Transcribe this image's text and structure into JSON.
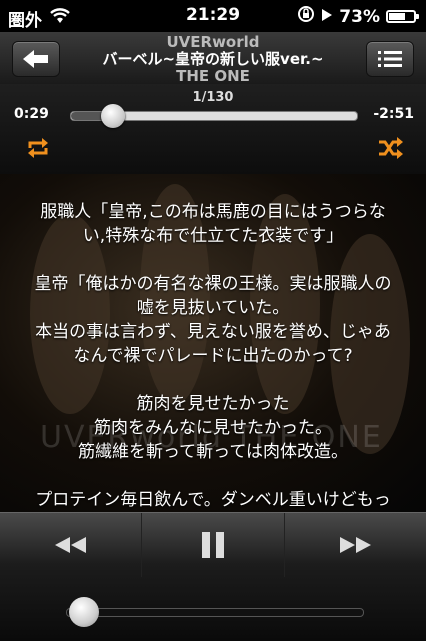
{
  "status_bar": {
    "carrier": "圏外",
    "time": "21:29",
    "battery": "73%",
    "battery_level": 0.73,
    "icons": [
      "wifi-icon",
      "rotation-lock-icon",
      "play-icon",
      "battery-icon"
    ]
  },
  "header": {
    "artist": "UVERworld",
    "song": "バーベル~皇帝の新しい服ver.~",
    "album": "THE ONE"
  },
  "scrubber": {
    "track_count": "1/130",
    "elapsed": "0:29",
    "remaining": "-2:51",
    "progress": 0.147
  },
  "lyrics": [
    "服職人「皇帝,この布は馬鹿の目にはうつらな",
    "い,特殊な布で仕立てた衣装です」",
    "",
    "皇帝「俺はかの有名な裸の王様。実は服職人の",
    "嘘を見抜いていた。",
    "本当の事は言わず、見えない服を誉め、じゃあ",
    "なんで裸でパレードに出たのかって?",
    "",
    "筋肉を見せたかった",
    "筋肉をみんなに見せたかった。",
    "筋繊維を斬って斬っては肉体改造。",
    "",
    "プロテイン毎日飲んで。ダンベル重いけどもっ"
  ],
  "album_art_text": "UVERworld THE ONE",
  "volume": {
    "level": 0.06
  },
  "colors": {
    "accent": "#f0901e"
  }
}
